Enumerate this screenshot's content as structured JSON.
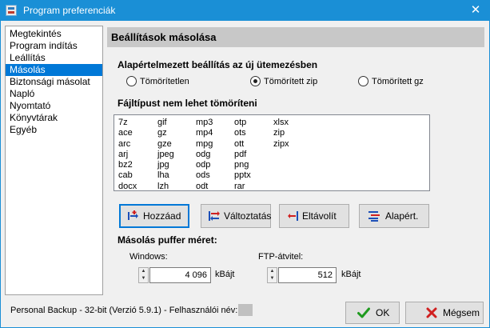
{
  "window": {
    "title": "Program preferenciák"
  },
  "sidebar": {
    "items": [
      {
        "label": "Megtekintés"
      },
      {
        "label": "Program indítás"
      },
      {
        "label": "Leállítás"
      },
      {
        "label": "Másolás",
        "selected": true
      },
      {
        "label": "Biztonsági másolat"
      },
      {
        "label": "Napló"
      },
      {
        "label": "Nyomtató"
      },
      {
        "label": "Könyvtárak"
      },
      {
        "label": "Egyéb"
      }
    ]
  },
  "panel": {
    "title": "Beállítások másolása",
    "default_settings": {
      "label": "Alapértelmezett beállítás az új ütemezésben",
      "options": [
        {
          "label": "Tömörítetlen",
          "selected": false
        },
        {
          "label": "Tömörített zip",
          "selected": true
        },
        {
          "label": "Tömörített gz",
          "selected": false
        }
      ]
    },
    "no_compress": {
      "label": "Fájltípust nem lehet tömöríteni",
      "columns": [
        [
          "7z",
          "ace",
          "arc",
          "arj",
          "bz2",
          "cab",
          "docx"
        ],
        [
          "gif",
          "gz",
          "gze",
          "jpeg",
          "jpg",
          "lha",
          "lzh"
        ],
        [
          "mp3",
          "mp4",
          "mpg",
          "odg",
          "odp",
          "ods",
          "odt"
        ],
        [
          "otp",
          "ots",
          "ott",
          "pdf",
          "png",
          "pptx",
          "rar"
        ],
        [
          "xlsx",
          "zip",
          "zipx"
        ]
      ]
    },
    "buttons": {
      "add": "Hozzáad",
      "change": "Változtatás",
      "remove": "Eltávolít",
      "default": "Alapért."
    },
    "buffer": {
      "label": "Másolás puffer méret:",
      "windows_label": "Windows:",
      "windows_value": "4 096",
      "windows_unit": "kBájt",
      "ftp_label": "FTP-átvitel:",
      "ftp_value": "512",
      "ftp_unit": "kBájt"
    }
  },
  "status": {
    "text": "Personal Backup - 32-bit (Verzió 5.9.1) - Felhasználói név:"
  },
  "footer": {
    "ok": "OK",
    "cancel": "Mégsem"
  },
  "colors": {
    "titlebar": "#1a8fd6",
    "selection": "#0078d7",
    "panel_header": "#c8c8c8"
  }
}
